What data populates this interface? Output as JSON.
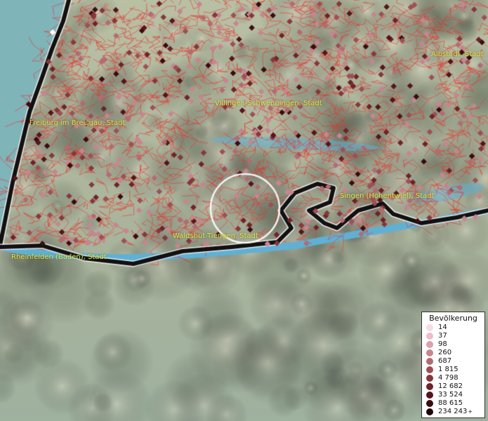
{
  "map": {
    "places": [
      {
        "id": "albstadt",
        "name": "Albstadt, Stadt"
      },
      {
        "id": "villingen",
        "name": "Villingen-Schwenningen, Stadt"
      },
      {
        "id": "freiburg",
        "name": "Freiburg im Breisgau, Stadt"
      },
      {
        "id": "singen",
        "name": "Singen (Hohentwiel), Stadt"
      },
      {
        "id": "waldshut",
        "name": "Waldshut-Tiengen, Stadt"
      },
      {
        "id": "rheinfelden",
        "name": "Rheinfelden (Baden), Stadt"
      }
    ],
    "colors": {
      "borders": "#e8322e",
      "water": "#4aa8d8",
      "label": "#e3e44a"
    }
  },
  "legend": {
    "title": "Bevölkerung",
    "items": [
      {
        "label": "14",
        "color": "#f7dce6"
      },
      {
        "label": "37",
        "color": "#ecbdcb"
      },
      {
        "label": "98",
        "color": "#dca0b0"
      },
      {
        "label": "260",
        "color": "#c9848f"
      },
      {
        "label": "687",
        "color": "#b56a72"
      },
      {
        "label": "1 815",
        "color": "#9e4f55"
      },
      {
        "label": "4 798",
        "color": "#87373c"
      },
      {
        "label": "12 682",
        "color": "#6e2328"
      },
      {
        "label": "33 524",
        "color": "#55151a"
      },
      {
        "label": "88 615",
        "color": "#3b0b0f"
      },
      {
        "label": "234 243",
        "color": "#220407"
      }
    ],
    "plus": "+"
  }
}
